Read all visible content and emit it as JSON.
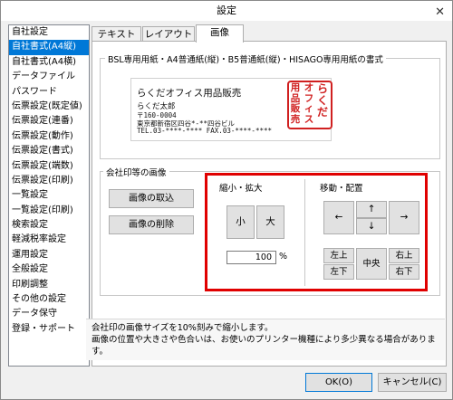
{
  "window": {
    "title": "設定",
    "close_icon": "close-icon"
  },
  "sidebar": {
    "items": [
      "自社設定",
      "自社書式(A4縦)",
      "自社書式(A4横)",
      "データファイル",
      "パスワード",
      "伝票設定(既定値)",
      "伝票設定(連番)",
      "伝票設定(動作)",
      "伝票設定(書式)",
      "伝票設定(端数)",
      "伝票設定(印刷)",
      "一覧設定",
      "一覧設定(印刷)",
      "検索設定",
      "軽減税率設定",
      "運用設定",
      "全般設定",
      "印刷調整",
      "その他の設定",
      "データ保守",
      "登録・サポート"
    ],
    "selected_index": 1
  },
  "tabs": {
    "text": "テキスト",
    "layout": "レイアウト",
    "image": "画像",
    "active": "image"
  },
  "format_group": {
    "title": "BSL専用用紙・A4普通紙(縦)・B5普通紙(縦)・HISAGO専用用紙の書式"
  },
  "preview": {
    "company": "らくだオフィス用品販売",
    "name": "らくだ太郎",
    "postal": "〒160-0004",
    "address": "東京都新宿区四谷*-**四谷ビル",
    "tel_fax": "TEL.03-****-****    FAX.03-****-****",
    "stamp_col1": "らくだ",
    "stamp_col2": "オフィス",
    "stamp_col3": "用品販売"
  },
  "seal_group": {
    "title": "会社印等の画像",
    "import_button": "画像の取込",
    "delete_button": "画像の削除"
  },
  "scale": {
    "title": "縮小・拡大",
    "small_button": "小",
    "large_button": "大",
    "value": "100",
    "unit": "%"
  },
  "move": {
    "title": "移動・配置",
    "left": "←",
    "up": "↑",
    "down": "↓",
    "right": "→",
    "top_left": "左上",
    "bottom_left": "左下",
    "center": "中央",
    "top_right": "右上",
    "bottom_right": "右下"
  },
  "info": {
    "line1": "会社印の画像サイズを10%刻みで縮小します。",
    "line2": "画像の位置や大きさや色合いは、お使いのプリンター機種により多少異なる場合があります。"
  },
  "buttons": {
    "ok": "OK(O)",
    "cancel": "キャンセル(C)"
  },
  "colors": {
    "selection": "#0078d7",
    "highlight_box": "#e00000",
    "stamp": "#d02020"
  }
}
